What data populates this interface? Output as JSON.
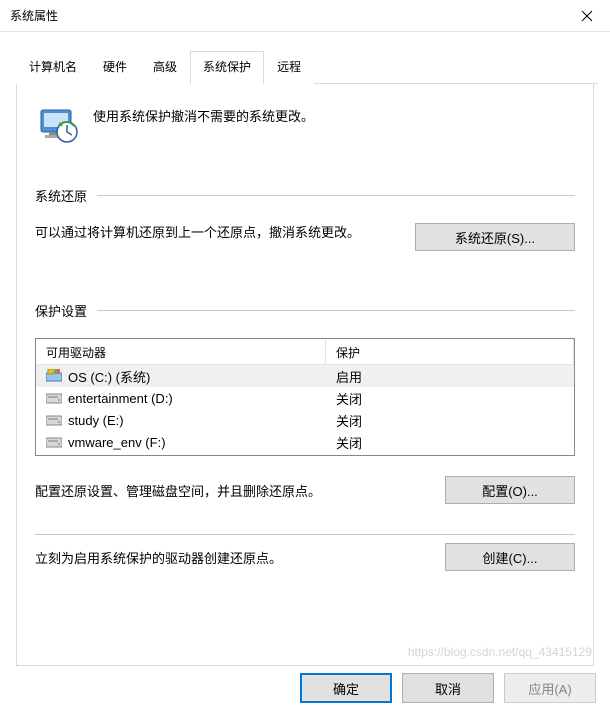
{
  "window": {
    "title": "系统属性"
  },
  "tabs": [
    {
      "label": "计算机名"
    },
    {
      "label": "硬件"
    },
    {
      "label": "高级"
    },
    {
      "label": "系统保护",
      "active": true
    },
    {
      "label": "远程"
    }
  ],
  "intro": {
    "text": "使用系统保护撤消不需要的系统更改。"
  },
  "sections": {
    "restore": {
      "title": "系统还原",
      "text": "可以通过将计算机还原到上一个还原点，撤消系统更改。",
      "button": "系统还原(S)..."
    },
    "protection": {
      "title": "保护设置",
      "columns": {
        "drive": "可用驱动器",
        "protection": "保护"
      },
      "drives": [
        {
          "name": "OS (C:) (系统)",
          "protection": "启用",
          "selected": true,
          "icon": "os"
        },
        {
          "name": "entertainment (D:)",
          "protection": "关闭",
          "selected": false,
          "icon": "hdd"
        },
        {
          "name": "study (E:)",
          "protection": "关闭",
          "selected": false,
          "icon": "hdd"
        },
        {
          "name": "vmware_env (F:)",
          "protection": "关闭",
          "selected": false,
          "icon": "hdd"
        }
      ],
      "config_text": "配置还原设置、管理磁盘空间，并且删除还原点。",
      "config_button": "配置(O)...",
      "create_text": "立刻为启用系统保护的驱动器创建还原点。",
      "create_button": "创建(C)..."
    }
  },
  "footer": {
    "ok": "确定",
    "cancel": "取消",
    "apply": "应用(A)"
  },
  "watermark": "https://blog.csdn.net/qq_43415129"
}
